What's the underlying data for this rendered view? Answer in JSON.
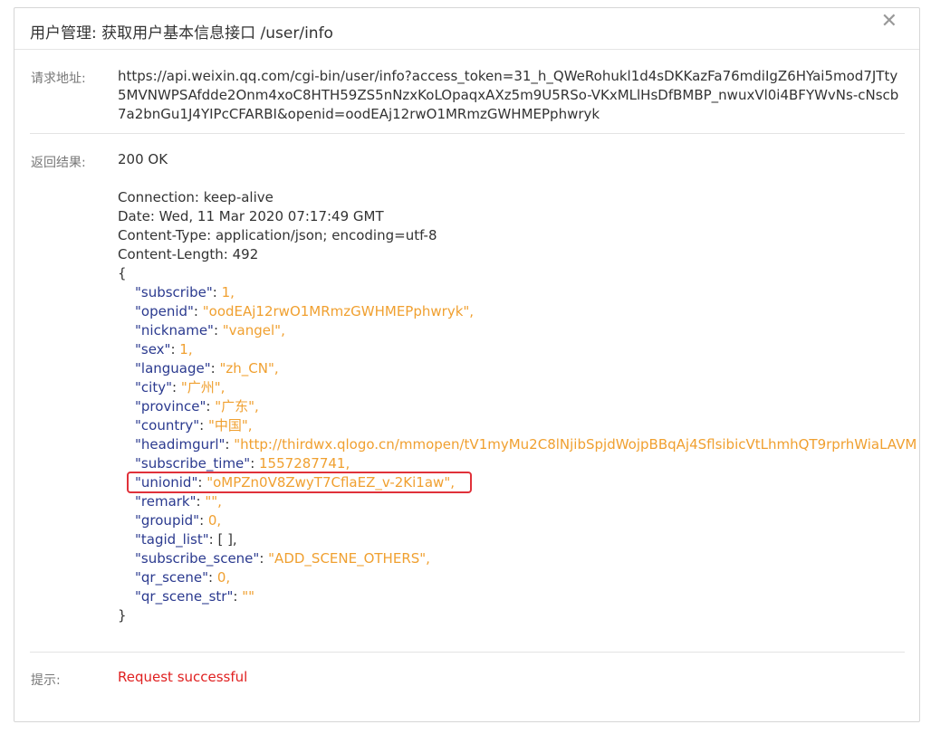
{
  "dialog": {
    "title": "用户管理: 获取用户基本信息接口 /user/info",
    "close_glyph": "✕"
  },
  "request": {
    "label": "请求地址:",
    "url": "https://api.weixin.qq.com/cgi-bin/user/info?access_token=31_h_QWeRohukl1d4sDKKazFa76mdiIgZ6HYai5mod7JTty5MVNWPSAfdde2Onm4xoC8HTH59ZS5nNzxKoLOpaqxAXz5m9U5RSo-VKxMLlHsDfBMBP_nwuxVl0i4BFYWvNs-cNscb7a2bnGu1J4YIPcCFARBI&openid=oodEAj12rwO1MRmzGWHMEPphwryk"
  },
  "result": {
    "label": "返回结果:",
    "status": "200 OK",
    "headers": [
      "Connection: keep-alive",
      "Date: Wed, 11 Mar 2020 07:17:49 GMT",
      "Content-Type: application/json; encoding=utf-8",
      "Content-Length: 492"
    ],
    "open_brace": "{",
    "close_brace": "}",
    "body": [
      {
        "key": "\"subscribe\"",
        "sep": ": ",
        "value": "1,",
        "type": "num"
      },
      {
        "key": "\"openid\"",
        "sep": ": ",
        "value": "\"oodEAj12rwO1MRmzGWHMEPphwryk\",",
        "type": "str"
      },
      {
        "key": "\"nickname\"",
        "sep": ": ",
        "value": "\"vangel\",",
        "type": "str"
      },
      {
        "key": "\"sex\"",
        "sep": ": ",
        "value": "1,",
        "type": "num"
      },
      {
        "key": "\"language\"",
        "sep": ": ",
        "value": "\"zh_CN\",",
        "type": "str"
      },
      {
        "key": "\"city\"",
        "sep": ": ",
        "value": "\"广州\",",
        "type": "str"
      },
      {
        "key": "\"province\"",
        "sep": ": ",
        "value": "\"广东\",",
        "type": "str"
      },
      {
        "key": "\"country\"",
        "sep": ": ",
        "value": "\"中国\",",
        "type": "str"
      },
      {
        "key": "\"headimgurl\"",
        "sep": ": ",
        "value": "\"http://thirdwx.qlogo.cn/mmopen/tV1myMu2C8lNjibSpjdWojpBBqAj4SflsibicVtLhmhQT9rprhWiaLAVM",
        "type": "str"
      },
      {
        "key": "\"subscribe_time\"",
        "sep": ": ",
        "value": "1557287741,",
        "type": "num"
      },
      {
        "key": "\"unionid\"",
        "sep": ": ",
        "value": "\"oMPZn0V8ZwyT7CflaEZ_v-2Ki1aw\",",
        "type": "str"
      },
      {
        "key": "\"remark\"",
        "sep": ": ",
        "value": "\"\",",
        "type": "str"
      },
      {
        "key": "\"groupid\"",
        "sep": ": ",
        "value": "0,",
        "type": "num"
      },
      {
        "key": "\"tagid_list\"",
        "sep": ": ",
        "value": "[ ],",
        "type": "plain"
      },
      {
        "key": "\"subscribe_scene\"",
        "sep": ": ",
        "value": "\"ADD_SCENE_OTHERS\",",
        "type": "str"
      },
      {
        "key": "\"qr_scene\"",
        "sep": ": ",
        "value": "0,",
        "type": "num"
      },
      {
        "key": "\"qr_scene_str\"",
        "sep": ": ",
        "value": "\"\"",
        "type": "str"
      }
    ],
    "highlighted_key": "unionid",
    "highlight_color": "#e0313a"
  },
  "tip": {
    "label": "提示:",
    "message": "Request successful",
    "color": "#e02020"
  },
  "colors": {
    "json_key": "#2b3a8f",
    "json_value": "#f0a030"
  }
}
